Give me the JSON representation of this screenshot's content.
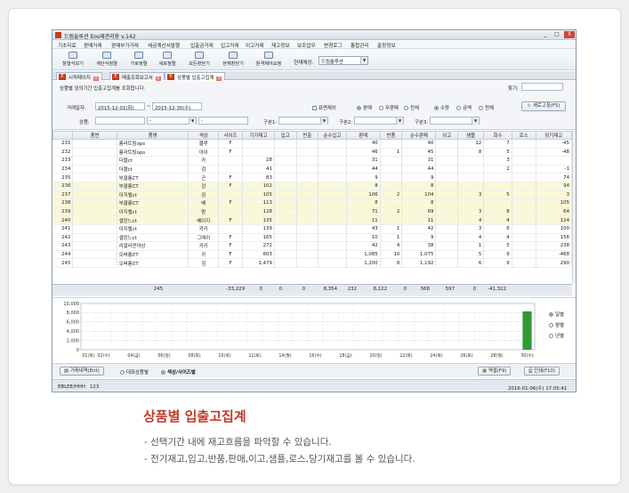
{
  "window": {
    "title": "드림솔루션 Eos재관리용 v.142",
    "minimize": "_",
    "maximize": "□",
    "close": "X"
  },
  "menu": [
    "기초자료",
    "판매거래",
    "판매부가거래",
    "세금계산서발행",
    "입출금거래",
    "입고거래",
    "이고거래",
    "재고정보",
    "보조업무",
    "변경로그",
    "통합관리",
    "출장정보"
  ],
  "toolbar": {
    "buttons": [
      "창형식보기",
      "계단식정렬",
      "가로정렬",
      "세로정렬",
      "모든창닫기",
      "현재창닫기",
      "원격제어요청"
    ],
    "branch_label": "현재매장:",
    "branch_value": "드림솔루션"
  },
  "tabs": [
    {
      "icon": "E",
      "label": "시작페이지",
      "close": "x"
    },
    {
      "icon": "E",
      "label": "매출조회보고서",
      "close": "x"
    },
    {
      "icon": "E",
      "label": "상품별 입출고집계",
      "close": "x"
    }
  ],
  "filters": {
    "description": "상품별 임의기간 입출고집계를 조회합니다.",
    "search_label": "찾기:",
    "period_label": "거래일자:",
    "date_from": "2015-12-01(화)",
    "tilde": "~",
    "date_to": "2015-12-30(수)",
    "product_label": "상품:",
    "dash": "-",
    "div1_label": "구분1:",
    "div2_label": "구분2:",
    "div3_label": "구분3:",
    "exclude_label": "표면제외",
    "sale_radios": [
      "판매",
      "무판매",
      "전체"
    ],
    "qty_radios": [
      "수량",
      "금액",
      "전체"
    ],
    "refresh": "새로고침(F5)"
  },
  "grid": {
    "headers": [
      "",
      "품번",
      "품명",
      "색상",
      "사이즈",
      "기가재고",
      "입고",
      "반출",
      "순수입고",
      "판매",
      "반품",
      "순수판매",
      "이고",
      "샘플",
      "회수",
      "로스",
      "당기재고"
    ],
    "rows": [
      [
        "231",
        "",
        "롱라트팅ops",
        "블루",
        "F",
        "",
        "",
        "",
        "",
        "40",
        "",
        "40",
        "",
        "12",
        "7",
        "",
        "-45"
      ],
      [
        "232",
        "",
        "롱라트팅ops",
        "아이",
        "F",
        "",
        "",
        "",
        "",
        "46",
        "1",
        "45",
        "",
        "8",
        "5",
        "",
        "-48"
      ],
      [
        "233",
        "",
        "더블ct",
        "카",
        "",
        "28",
        "",
        "",
        "",
        "31",
        "",
        "31",
        "",
        "",
        "3",
        "",
        ""
      ],
      [
        "234",
        "",
        "더블ct",
        "검",
        "",
        "41",
        "",
        "",
        "",
        "44",
        "",
        "44",
        "",
        "",
        "2",
        "",
        "-1"
      ],
      [
        "235",
        "",
        "부클롱CT",
        "곤",
        "F",
        "83",
        "",
        "",
        "",
        "9",
        "",
        "9",
        "",
        "",
        "",
        "",
        "74"
      ],
      [
        "236",
        "",
        "부클롱CT",
        "검",
        "F",
        "102",
        "",
        "",
        "",
        "8",
        "",
        "8",
        "",
        "",
        "",
        "",
        "94"
      ],
      [
        "237",
        "",
        "이지벨ct",
        "검",
        "",
        "105",
        "",
        "",
        "",
        "106",
        "2",
        "104",
        "",
        "3",
        "5",
        "",
        "3"
      ],
      [
        "238",
        "",
        "부클롱CT",
        "베",
        "F",
        "113",
        "",
        "",
        "",
        "8",
        "",
        "8",
        "",
        "",
        "",
        "",
        "105"
      ],
      [
        "239",
        "",
        "이지벨ct",
        "밤",
        "",
        "128",
        "",
        "",
        "",
        "71",
        "2",
        "69",
        "",
        "3",
        "8",
        "",
        "64"
      ],
      [
        "240",
        "",
        "셀린느ct",
        "베이지",
        "F",
        "135",
        "",
        "",
        "",
        "11",
        "",
        "11",
        "",
        "4",
        "4",
        "",
        "124"
      ],
      [
        "241",
        "",
        "이지벨ct",
        "카키",
        "",
        "139",
        "",
        "",
        "",
        "43",
        "1",
        "42",
        "",
        "3",
        "6",
        "",
        "100"
      ],
      [
        "242",
        "",
        "셀린느ct",
        "그레이",
        "F",
        "165",
        "",
        "",
        "",
        "10",
        "1",
        "9",
        "",
        "4",
        "4",
        "",
        "156"
      ],
      [
        "243",
        "",
        "리얼라쿤야상",
        "카키",
        "F",
        "272",
        "",
        "",
        "",
        "42",
        "4",
        "38",
        "",
        "1",
        "5",
        "",
        "238"
      ],
      [
        "244",
        "",
        "오버롱CT",
        "카",
        "F",
        "603",
        "",
        "",
        "",
        "1,085",
        "10",
        "1,075",
        "",
        "5",
        "9",
        "",
        "-468"
      ],
      [
        "245",
        "",
        "오버롱CT",
        "검",
        "F",
        "1,479",
        "",
        "",
        "",
        "1,200",
        "8",
        "1,192",
        "",
        "6",
        "9",
        "",
        "290"
      ]
    ],
    "highlight_rows": [
      5,
      6,
      7,
      8,
      9
    ],
    "summary": {
      "count": "245",
      "stock_prev": "-33,229",
      "in": "0",
      "out": "0",
      "net_in": "0",
      "sale": "8,354",
      "return": "232",
      "net_sale": "8,122",
      "transfer": "0",
      "sample": "568",
      "recall": "597",
      "loss": "0",
      "stock_now": "-41,322"
    }
  },
  "chart_data": {
    "type": "bar",
    "title": "",
    "xlabel": "",
    "ylabel": "",
    "categories": [
      "01(화)",
      "02(수)",
      "03",
      "04(금)",
      "05",
      "06(일)",
      "07",
      "08(화)",
      "09",
      "10(목)",
      "11",
      "12(토)",
      "13",
      "14(월)",
      "15",
      "16(수)",
      "17",
      "18(금)",
      "19",
      "20(일)",
      "21",
      "22(화)",
      "23",
      "24(목)",
      "25",
      "26(토)",
      "27",
      "28(월)",
      "29",
      "30(수)"
    ],
    "tick_labels": [
      "01(화)",
      "02(수)",
      "04(금)",
      "06(일)",
      "08(화)",
      "10(목)",
      "12(토)",
      "14(월)",
      "16(수)",
      "18(금)",
      "20(일)",
      "22(화)",
      "24(목)",
      "26(토)",
      "28(월)",
      "30(수)"
    ],
    "values": [
      0,
      0,
      0,
      0,
      0,
      0,
      0,
      0,
      0,
      0,
      0,
      0,
      0,
      0,
      0,
      0,
      0,
      0,
      0,
      0,
      0,
      0,
      0,
      0,
      0,
      0,
      0,
      0,
      0,
      8300
    ],
    "ylim": [
      0,
      10000
    ],
    "yticks": [
      "10,000",
      "8,000",
      "6,000",
      "4,000",
      "2,000",
      "0"
    ],
    "bar_color": "#2f9a33",
    "grid": true,
    "period_radios": [
      "일별",
      "월별",
      "년별"
    ]
  },
  "bottom": {
    "ledger": "거래내역(Ent)",
    "rep_product": "대표상품별",
    "color_size": "색상/사이즈별",
    "excel": "엑셀(F9)",
    "print": "인쇄(F10)"
  },
  "status": {
    "user": "EBLEE/HHH",
    "code": "123",
    "datetime": "2016-01-06(수) 17:05:41"
  },
  "caption": {
    "title": "상품별 입출고집계",
    "lines": [
      "- 선택기간 내에 재고흐름을 파악할 수 있습니다.",
      "- 전기재고,입고,반품,판매,이고,샘플,로스,당기재고를 볼 수 있습니다."
    ]
  }
}
